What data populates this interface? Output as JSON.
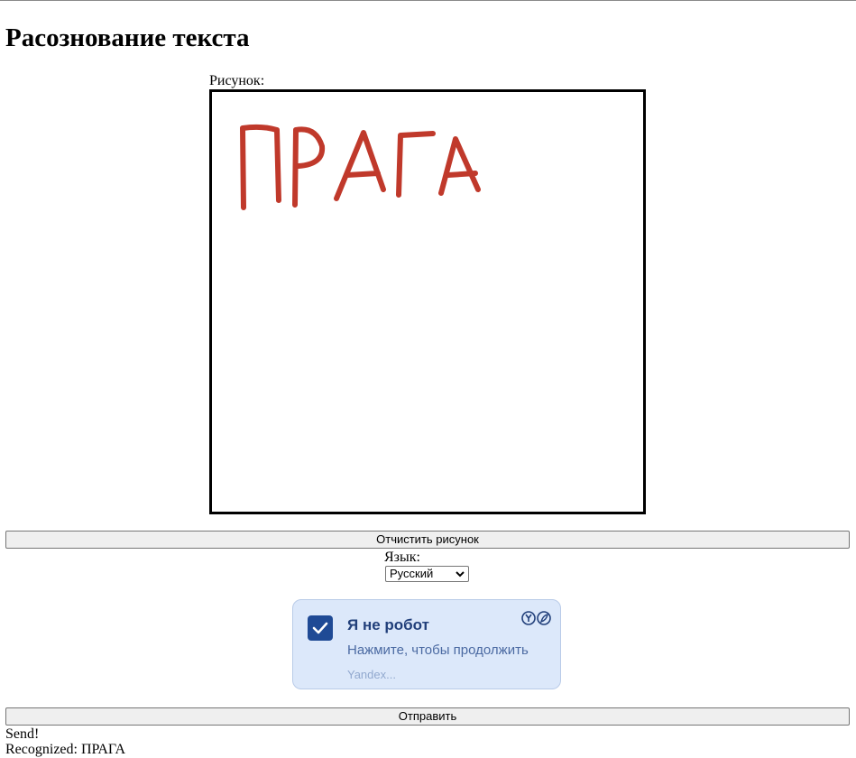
{
  "page": {
    "title": "Расознование текста"
  },
  "canvas": {
    "label": "Рисунок:",
    "stroke_color": "#c0392b",
    "drawn_text": "ПРАГА"
  },
  "controls": {
    "clear_label": "Отчистить рисунок",
    "language_label": "Язык:",
    "language_selected": "Русский",
    "submit_label": "Отправить"
  },
  "captcha": {
    "checked": true,
    "title": "Я не робот",
    "subtitle": "Нажмите, чтобы продолжить",
    "brand": "Yandex...",
    "accent": "#1f4a95",
    "background": "#dce8fa"
  },
  "status": {
    "sent": "Send!",
    "recognized": "Recognized: ПРАГА"
  }
}
